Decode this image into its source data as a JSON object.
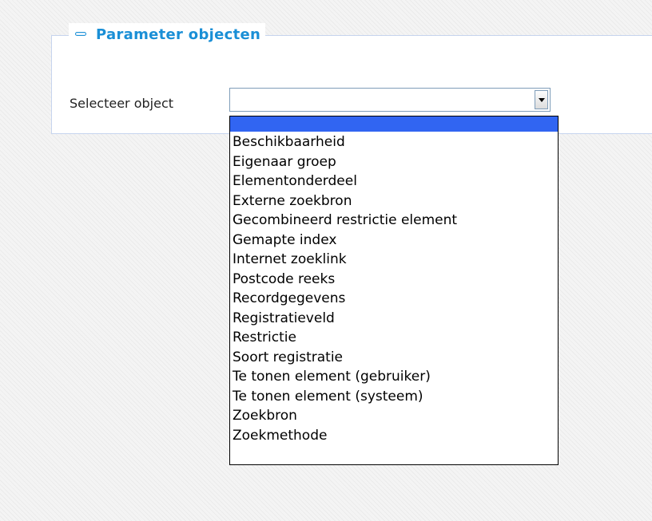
{
  "section": {
    "title": "Parameter objecten"
  },
  "field": {
    "label": "Selecteer object",
    "value": ""
  },
  "dropdown": {
    "highlighted_index": 0,
    "options": [
      "",
      "Beschikbaarheid",
      "Eigenaar groep",
      "Elementonderdeel",
      "Externe zoekbron",
      "Gecombineerd restrictie element",
      "Gemapte index",
      "Internet zoeklink",
      "Postcode reeks",
      "Recordgegevens",
      "Registratieveld",
      "Restrictie",
      "Soort registratie",
      "Te tonen element (gebruiker)",
      "Te tonen element (systeem)",
      "Zoekbron",
      "Zoekmethode"
    ]
  },
  "colors": {
    "title": "#1a8fd6",
    "highlight": "#3165f2",
    "panel_border": "#c6d4ee"
  },
  "icons": {
    "collapse": "minus-icon",
    "select_arrow": "triangle-down-icon"
  }
}
